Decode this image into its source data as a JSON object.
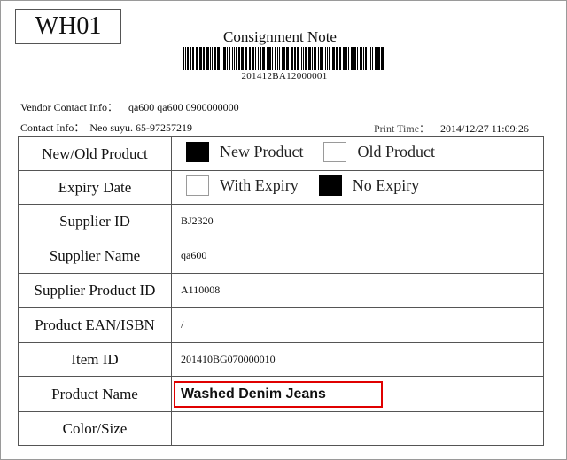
{
  "header": {
    "warehouse_code": "WH01",
    "title": "Consignment Note",
    "barcode_number": "201412BA12000001"
  },
  "info": {
    "vendor_label": "Vendor Contact Info：",
    "vendor_value": "qa600  qa600  0900000000",
    "contact_label": "Contact Info：",
    "contact_value": "Neo suyu.  65-97257219",
    "print_label": "Print Time：",
    "print_value": "2014/12/27 11:09:26"
  },
  "form": {
    "new_old": {
      "label": "New/Old Product",
      "options": [
        {
          "label": "New Product",
          "checked": true
        },
        {
          "label": "Old Product",
          "checked": false
        }
      ]
    },
    "expiry": {
      "label": "Expiry Date",
      "options": [
        {
          "label": "With Expiry",
          "checked": false
        },
        {
          "label": "No Expiry",
          "checked": true
        }
      ]
    },
    "supplier_id": {
      "label": "Supplier ID",
      "value": "BJ2320"
    },
    "supplier_name": {
      "label": "Supplier Name",
      "value": "qa600"
    },
    "supplier_product_id": {
      "label": "Supplier Product ID",
      "value": "A110008"
    },
    "ean": {
      "label": "Product EAN/ISBN",
      "value": "/"
    },
    "item_id": {
      "label": "Item ID",
      "value": "201410BG070000010"
    },
    "product_name": {
      "label": "Product Name",
      "value": "Washed Denim Jeans"
    },
    "color_size": {
      "label": "Color/Size",
      "value": ""
    }
  },
  "colors": {
    "highlight": "#e00000",
    "border": "#555555"
  }
}
